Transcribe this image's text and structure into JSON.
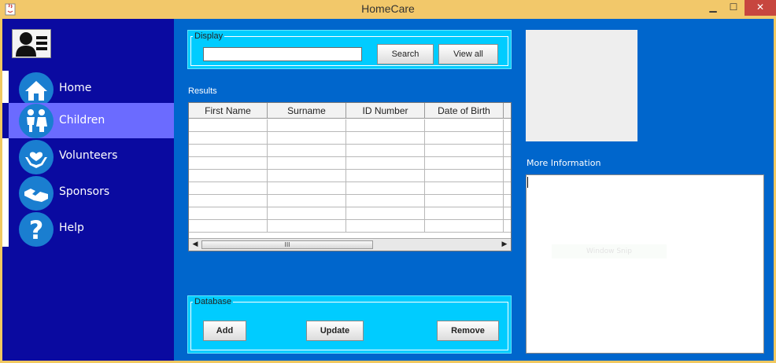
{
  "window": {
    "title": "HomeCare",
    "minimize_glyph": "▁",
    "maximize_glyph": "☐",
    "close_glyph": "✕"
  },
  "sidebar": {
    "items": [
      {
        "label": "Home",
        "icon": "home-icon"
      },
      {
        "label": "Children",
        "icon": "children-icon",
        "active": true
      },
      {
        "label": "Volunteers",
        "icon": "volunteers-icon"
      },
      {
        "label": "Sponsors",
        "icon": "handshake-icon"
      },
      {
        "label": "Help",
        "icon": "help-icon"
      }
    ]
  },
  "display": {
    "legend": "Display",
    "search_value": "",
    "search_button": "Search",
    "view_all_button": "View all"
  },
  "results": {
    "label": "Results",
    "columns": [
      "First Name",
      "Surname",
      "ID Number",
      "Date of Birth"
    ],
    "scroll_thumb_glyph": "III"
  },
  "database": {
    "legend": "Database",
    "add_button": "Add",
    "update_button": "Update",
    "remove_button": "Remove"
  },
  "details": {
    "more_info_label": "More Information",
    "more_info_value": "",
    "snap_overlay": "Window Snip"
  },
  "colors": {
    "sidebar": "#0a0aa0",
    "active_item": "#6b6bff",
    "content_bg": "#0066cc",
    "panel_bg": "#00ccff",
    "titlebar": "#f2c86a"
  }
}
